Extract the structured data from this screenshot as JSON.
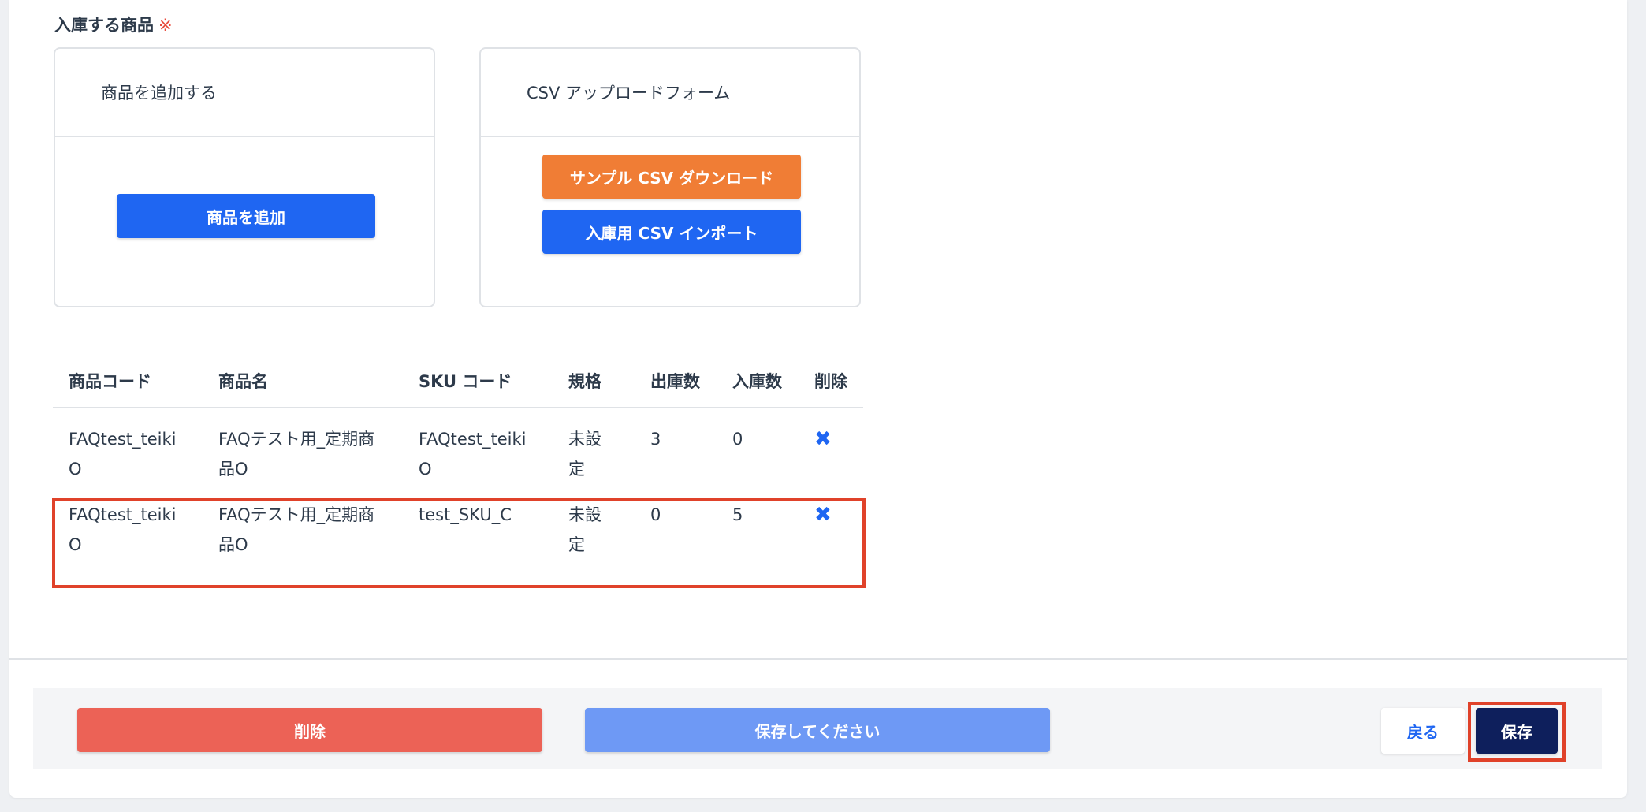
{
  "section": {
    "title": "入庫する商品",
    "required_mark": "※"
  },
  "add_card": {
    "title": "商品を追加する",
    "button": "商品を追加"
  },
  "csv_card": {
    "title": "CSV アップロードフォーム",
    "download_button": "サンプル CSV ダウンロード",
    "import_button": "入庫用 CSV インポート"
  },
  "table": {
    "headers": {
      "code": "商品コード",
      "name": "商品名",
      "sku": "SKU コード",
      "spec": "規格",
      "out": "出庫数",
      "in": "入庫数",
      "delete": "削除"
    },
    "rows": [
      {
        "code": "FAQtest_teikiO",
        "name": "FAQテスト用_定期商品O",
        "sku": "FAQtest_teikiO",
        "spec": "未設定",
        "out": "3",
        "in": "0",
        "delete_icon": "✖"
      },
      {
        "code": "FAQtest_teikiO",
        "name": "FAQテスト用_定期商品O",
        "sku": "test_SKU_C",
        "spec": "未設定",
        "out": "0",
        "in": "5",
        "delete_icon": "✖"
      }
    ]
  },
  "footer": {
    "delete_button": "削除",
    "save_prompt_button": "保存してください",
    "back_button": "戻る",
    "save_button": "保存"
  },
  "colors": {
    "primary": "#1f66f2",
    "orange": "#f07d35",
    "danger": "#ec6256",
    "navy": "#0e1f5c",
    "highlight": "#e0422a"
  }
}
